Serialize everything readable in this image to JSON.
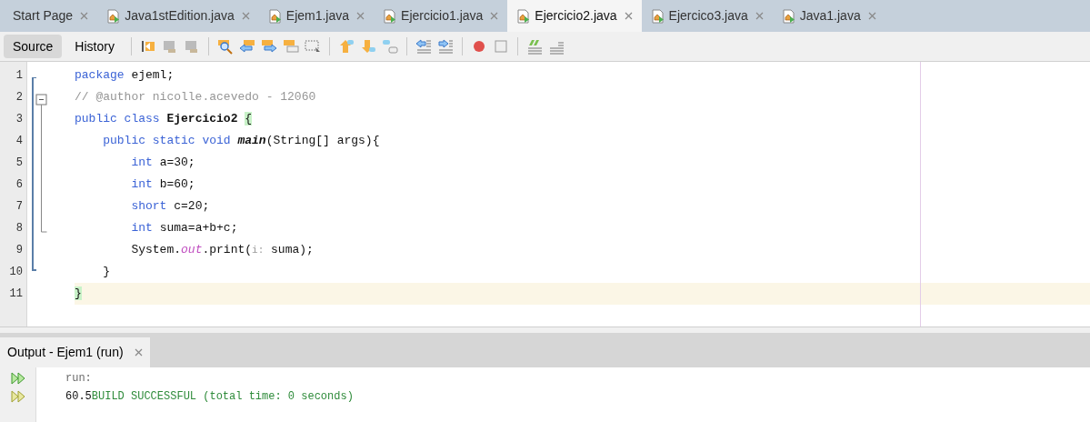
{
  "tabs": [
    {
      "label": "Start Page",
      "kind": "page",
      "selected": false
    },
    {
      "label": "Java1stEdition.java",
      "kind": "file",
      "selected": false
    },
    {
      "label": "Ejem1.java",
      "kind": "file",
      "selected": false
    },
    {
      "label": "Ejercicio1.java",
      "kind": "file",
      "selected": false
    },
    {
      "label": "Ejercicio2.java",
      "kind": "file",
      "selected": true
    },
    {
      "label": "Ejercico3.java",
      "kind": "file",
      "selected": false
    },
    {
      "label": "Java1.java",
      "kind": "file",
      "selected": false
    }
  ],
  "view_tabs": [
    {
      "label": "Source",
      "selected": true
    },
    {
      "label": "History",
      "selected": false
    }
  ],
  "editor": {
    "lines": [
      {
        "number": "1",
        "current": false,
        "tokens": [
          {
            "text": "package",
            "kind": "keyword"
          },
          {
            "text": " ejeml;",
            "kind": "plain"
          }
        ]
      },
      {
        "number": "2",
        "current": false,
        "tokens": [
          {
            "text": "// @author nicolle.acevedo - 12060",
            "kind": "comment"
          }
        ]
      },
      {
        "number": "3",
        "current": false,
        "tokens": [
          {
            "text": "public class ",
            "kind": "keyword"
          },
          {
            "text": "Ejercicio2 ",
            "kind": "bold"
          },
          {
            "text": "{",
            "kind": "brace"
          }
        ]
      },
      {
        "number": "4",
        "current": false,
        "tokens": [
          {
            "text": "    public static void ",
            "kind": "keyword"
          },
          {
            "text": "main",
            "kind": "method"
          },
          {
            "text": "(String[] args){",
            "kind": "plain"
          }
        ]
      },
      {
        "number": "5",
        "current": false,
        "tokens": [
          {
            "text": "        int",
            "kind": "keyword"
          },
          {
            "text": " a=30;",
            "kind": "plain"
          }
        ]
      },
      {
        "number": "6",
        "current": false,
        "tokens": [
          {
            "text": "        int",
            "kind": "keyword"
          },
          {
            "text": " b=60;",
            "kind": "plain"
          }
        ]
      },
      {
        "number": "7",
        "current": false,
        "tokens": [
          {
            "text": "        short",
            "kind": "keyword"
          },
          {
            "text": " c=20;",
            "kind": "plain"
          }
        ]
      },
      {
        "number": "8",
        "current": false,
        "tokens": [
          {
            "text": "        int",
            "kind": "keyword"
          },
          {
            "text": " suma=a+b+c;",
            "kind": "plain"
          }
        ]
      },
      {
        "number": "9",
        "current": false,
        "tokens": [
          {
            "text": "        System.",
            "kind": "plain"
          },
          {
            "text": "out",
            "kind": "field"
          },
          {
            "text": ".print(",
            "kind": "plain"
          },
          {
            "text": "i:",
            "kind": "hint"
          },
          {
            "text": " suma);",
            "kind": "plain"
          }
        ]
      },
      {
        "number": "10",
        "current": false,
        "tokens": [
          {
            "text": "    }",
            "kind": "plain"
          }
        ]
      },
      {
        "number": "11",
        "current": true,
        "tokens": [
          {
            "text": "}",
            "kind": "brace"
          }
        ]
      }
    ]
  },
  "output": {
    "title": "Output - Ejem1 (run)",
    "lines": [
      {
        "tokens": [
          {
            "text": "run:",
            "kind": "muted"
          }
        ]
      },
      {
        "tokens": [
          {
            "text": "60.5",
            "kind": "plain"
          },
          {
            "text": "BUILD SUCCESSFUL (total time: 0 seconds)",
            "kind": "success"
          }
        ]
      }
    ]
  }
}
